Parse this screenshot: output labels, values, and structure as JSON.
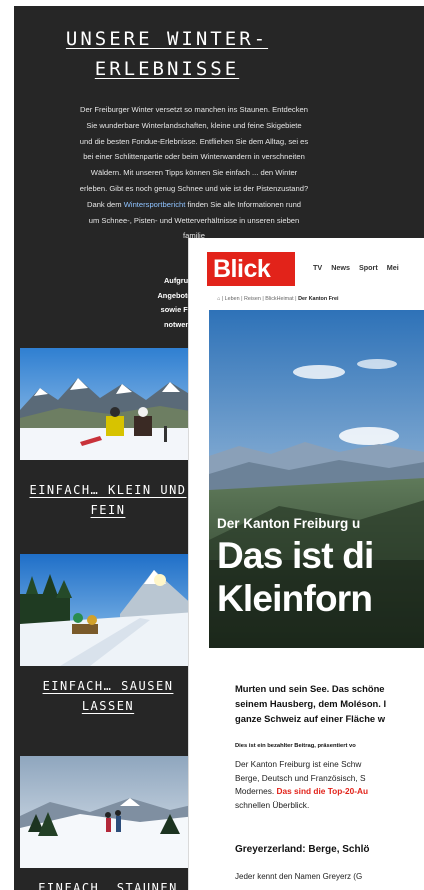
{
  "back_page": {
    "title_line1": "UNSERE WINTER-",
    "title_line2": "ERLEBNISSE",
    "intro": {
      "lines": [
        "Der Freiburger Winter versetzt so manchen ins Staunen. Entdecken",
        "Sie wunderbare Winterlandschaften, kleine und feine Skigebiete",
        "und die besten Fondue-Erlebnisse. Entfliehen Sie dem Alltag, sei es",
        "bei einer Schlittenpartie oder beim Winterwandern in verschneiten",
        "Wäldern. Mit unseren Tipps können Sie einfach ... den Winter",
        "erleben. Gibt es noch genug Schnee und wie ist der Pistenzustand?"
      ],
      "line7_before": "Dank dem ",
      "link_text": "Wintersportbericht",
      "line7_after": " finden Sie alle Informationen rund",
      "line8": "um Schnee-, Pisten- und Wetterverhältnisse in unseren sieben",
      "line9": "familie"
    },
    "notice_lines": [
      "Aufgrund der aktu",
      "Angebote unter Vorbe",
      "sowie Freizeit- und l",
      "notwendigen Infor"
    ],
    "cards": [
      {
        "title_line1": "EINFACH… KLEIN UND",
        "title_line2": "FEIN"
      },
      {
        "title_line1": "EINFACH… SAUSEN",
        "title_line2": "LASSEN"
      },
      {
        "title_line1": "EINFACH… STAUNEN",
        "title_line2": ""
      }
    ]
  },
  "front_page": {
    "logo": "Blick",
    "nav": [
      "TV",
      "News",
      "Sport",
      "Mei"
    ],
    "breadcrumb_prefix": "⌂ | Leben | Reisen | BlickHeimat | ",
    "breadcrumb_current": "Der Kanton Frei",
    "kicker": "Der Kanton Freiburg u",
    "headline_line1": "Das ist di",
    "headline_line2": "Kleinforn",
    "lead_lines": [
      "Murten und sein See. Das schöne",
      "seinem Hausberg, dem Moléson. I",
      "ganze Schweiz auf einer Fläche w"
    ],
    "sponsored": "Dies ist ein bezahlter Beitrag, präsentiert vo",
    "body_lines": [
      "Der Kanton Freiburg ist eine Schw",
      "Berge, Deutsch und Französisch, S"
    ],
    "body_line3_before": "Modernes. ",
    "body_line3_red": "Das sind die Top-20-Au",
    "body_line4": "schnellen Überblick.",
    "subhead": "Greyerzerland: Berge, Schlö",
    "teaser": "Jeder kennt den Namen Greyerz (G"
  },
  "colors": {
    "back_bg": "#262626",
    "blick_red": "#e2231a",
    "link_blue": "#8fc3ff"
  }
}
